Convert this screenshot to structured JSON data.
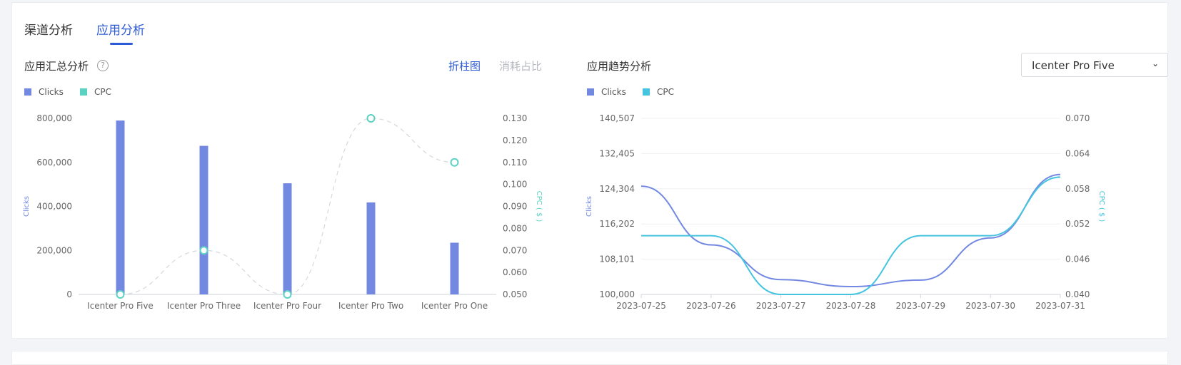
{
  "tabs": [
    {
      "label": "渠道分析",
      "active": false
    },
    {
      "label": "应用分析",
      "active": true
    }
  ],
  "summary": {
    "title": "应用汇总分析",
    "help_icon": "?",
    "toggles": [
      {
        "label": "折柱图",
        "active": true
      },
      {
        "label": "消耗占比",
        "active": false
      }
    ]
  },
  "trend": {
    "title": "应用趋势分析",
    "select": {
      "value": "Icenter Pro Five",
      "arrow": "⌄"
    }
  },
  "colors": {
    "clicks": "#7389e1",
    "cpc_left": "#5ad2c2",
    "cpc_right": "#45c4df",
    "accent": "#2d5bd6"
  },
  "chart_data": [
    {
      "type": "bar",
      "categories": [
        "Icenter Pro Five",
        "Icenter Pro Three",
        "Icenter Pro Four",
        "Icenter Pro Two",
        "Icenter Pro One"
      ],
      "series": [
        {
          "name": "Clicks",
          "type": "bar",
          "axis": "left",
          "values": [
            790000,
            675000,
            505000,
            418000,
            235000
          ]
        },
        {
          "name": "CPC",
          "type": "line",
          "axis": "right",
          "values": [
            0.05,
            0.07,
            0.05,
            0.13,
            0.11
          ]
        }
      ],
      "ylabel": "Clicks",
      "y2label": "CPC ( $ )",
      "ylim": [
        0,
        800000
      ],
      "y2lim": [
        0.05,
        0.13
      ],
      "yticks": [
        "0",
        "200,000",
        "400,000",
        "600,000",
        "800,000"
      ],
      "y2ticks": [
        "0.050",
        "0.060",
        "0.070",
        "0.080",
        "0.090",
        "0.100",
        "0.110",
        "0.120",
        "0.130"
      ],
      "legend": "top-left",
      "grid": false
    },
    {
      "type": "line",
      "x": [
        "2023-07-25",
        "2023-07-26",
        "2023-07-27",
        "2023-07-28",
        "2023-07-29",
        "2023-07-30",
        "2023-07-31"
      ],
      "series": [
        {
          "name": "Clicks",
          "axis": "left",
          "values": [
            124900,
            111400,
            103400,
            101800,
            103300,
            113000,
            127600
          ]
        },
        {
          "name": "CPC",
          "axis": "right",
          "values": [
            0.05,
            0.05,
            0.04,
            0.04,
            0.05,
            0.05,
            0.06
          ]
        }
      ],
      "ylabel": "Clicks",
      "y2label": "CPC ( $ )",
      "ylim": [
        100000,
        140507
      ],
      "y2lim": [
        0.04,
        0.07
      ],
      "yticks": [
        "100,000",
        "108,101",
        "116,202",
        "124,304",
        "132,405",
        "140,507"
      ],
      "y2ticks": [
        "0.040",
        "0.046",
        "0.052",
        "0.058",
        "0.064",
        "0.070"
      ],
      "legend": "top-left",
      "grid": true
    }
  ]
}
